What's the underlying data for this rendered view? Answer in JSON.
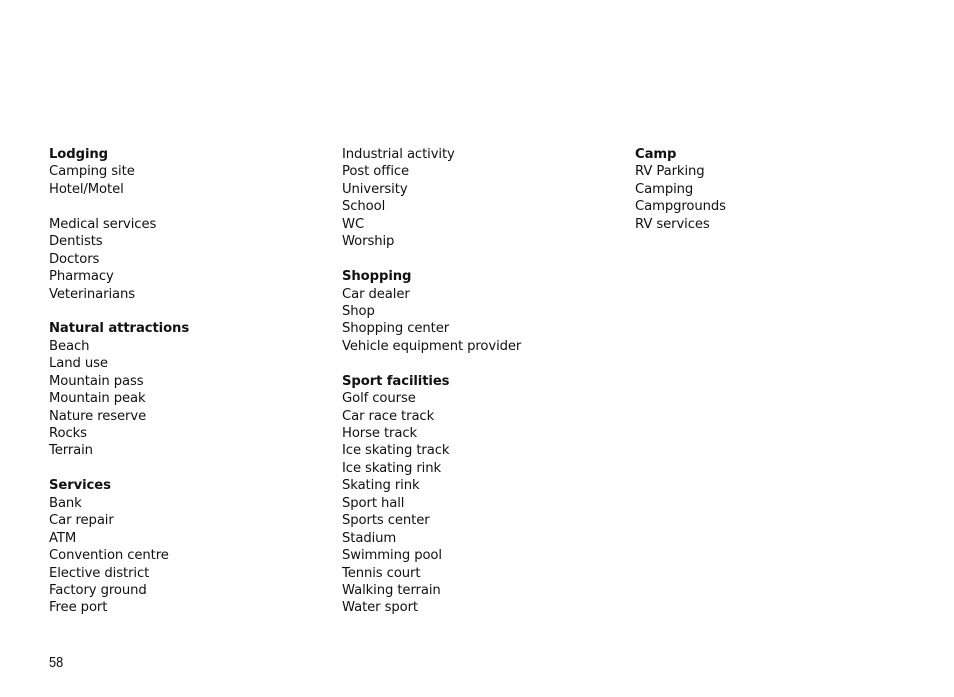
{
  "columns": [
    {
      "sections": [
        {
          "heading": "Lodging",
          "items": [
            "Camping site",
            "Hotel/Motel"
          ]
        },
        {
          "heading": "",
          "items": [
            "Medical services",
            "Dentists",
            "Doctors",
            "Pharmacy",
            "Veterinarians"
          ]
        },
        {
          "heading": "Natural attractions",
          "items": [
            "Beach",
            "Land use",
            "Mountain pass",
            "Mountain peak",
            "Nature reserve",
            "Rocks",
            "Terrain"
          ]
        },
        {
          "heading": "Services",
          "items": [
            "Bank",
            "Car repair",
            "ATM",
            "Convention centre",
            "Elective district",
            "Factory ground",
            "Free port"
          ]
        }
      ]
    },
    {
      "sections": [
        {
          "heading": "",
          "items": [
            "Industrial activity",
            "Post office",
            "University",
            "School",
            "WC",
            "Worship"
          ]
        },
        {
          "heading": "Shopping",
          "items": [
            "Car dealer",
            "Shop",
            "Shopping center",
            "Vehicle equipment provider"
          ]
        },
        {
          "heading": "Sport facilities",
          "items": [
            "Golf course",
            "Car race track",
            "Horse track",
            "Ice skating track",
            "Ice skating rink",
            "Skating rink",
            "Sport hall",
            "Sports center",
            "Stadium",
            "Swimming pool",
            "Tennis court",
            "Walking terrain",
            "Water sport"
          ]
        }
      ]
    },
    {
      "sections": [
        {
          "heading": "Camp",
          "items": [
            "RV Parking",
            "Camping",
            "Campgrounds",
            "RV services"
          ]
        }
      ]
    }
  ],
  "page_number": "58"
}
